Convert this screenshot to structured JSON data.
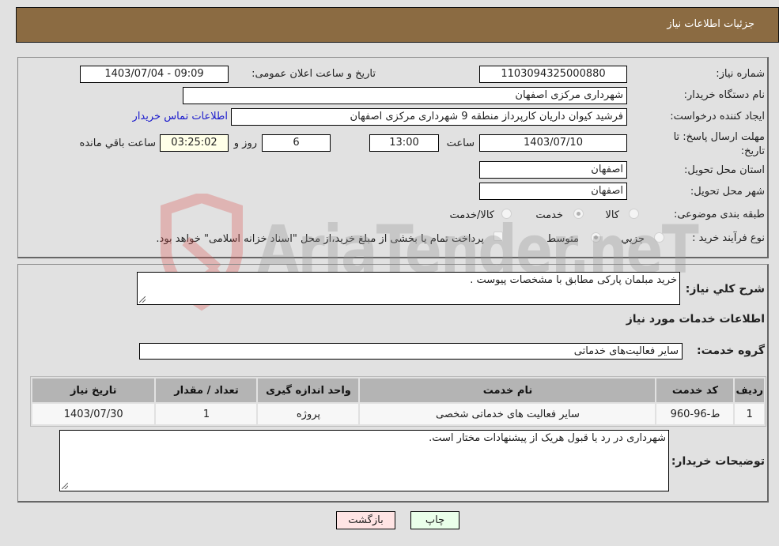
{
  "header": {
    "title": "جزئیات اطلاعات نیاز"
  },
  "details": {
    "need_number_label": "شماره نیاز:",
    "need_number": "1103094325000880",
    "announce_label": "تاریخ و ساعت اعلان عمومی:",
    "announce_value": "1403/07/04 - 09:09",
    "buyer_org_label": "نام دستگاه خریدار:",
    "buyer_org": "شهرداری مرکزی اصفهان",
    "creator_label": "ایجاد کننده درخواست:",
    "creator": "فرشید کیوان داریان کارپرداز منطقه 9 شهرداری مرکزی اصفهان",
    "contact_link": "اطلاعات تماس خریدار",
    "deadline_label": "مهلت ارسال پاسخ: تا تاریخ:",
    "deadline_date": "1403/07/10",
    "time_label": "ساعت",
    "deadline_time": "13:00",
    "days_value": "6",
    "days_label": "روز و",
    "remaining_time": "03:25:02",
    "remaining_label": "ساعت باقي مانده",
    "province_label": "استان محل تحویل:",
    "province": "اصفهان",
    "city_label": "شهر محل تحویل:",
    "city": "اصفهان",
    "category_label": "طبقه بندی موضوعی:",
    "category_options": [
      {
        "label": "کالا",
        "checked": false
      },
      {
        "label": "خدمت",
        "checked": true
      },
      {
        "label": "کالا/خدمت",
        "checked": false
      }
    ],
    "process_label": "نوع فرآیند خرید :",
    "process_options": [
      {
        "label": "جزيي",
        "checked": false
      },
      {
        "label": "متوسط",
        "checked": true
      }
    ],
    "treasury_note": "پرداخت تمام یا بخشی از مبلغ خرید،از محل \"اسناد خزانه اسلامی\" خواهد بود.",
    "treasury_checked": false
  },
  "summary": {
    "description_label": "شرح کلي نياز:",
    "description": "خرید مبلمان پارکی مطابق با مشخصات پیوست .",
    "services_heading": "اطلاعات خدمات مورد نياز",
    "service_group_label": "گروه خدمت:",
    "service_group": "سایر فعالیت‌های خدماتی"
  },
  "table": {
    "headers": [
      "ردیف",
      "کد خدمت",
      "نام خدمت",
      "واحد اندازه گیری",
      "تعداد / مقدار",
      "تاریخ نیاز"
    ],
    "rows": [
      [
        "1",
        "ط-96-960",
        "سایر فعالیت های خدماتی شخصی",
        "پروژه",
        "1",
        "1403/07/30"
      ]
    ]
  },
  "buyer_notes": {
    "label": "توضیحات خریدار:",
    "text": "شهرداری در رد یا قبول هریک از پیشنهادات مختار است."
  },
  "buttons": {
    "print": "چاپ",
    "back": "بازگشت"
  },
  "watermark": {
    "text": "AriaTender.neT",
    "accent": "#d9534f"
  }
}
